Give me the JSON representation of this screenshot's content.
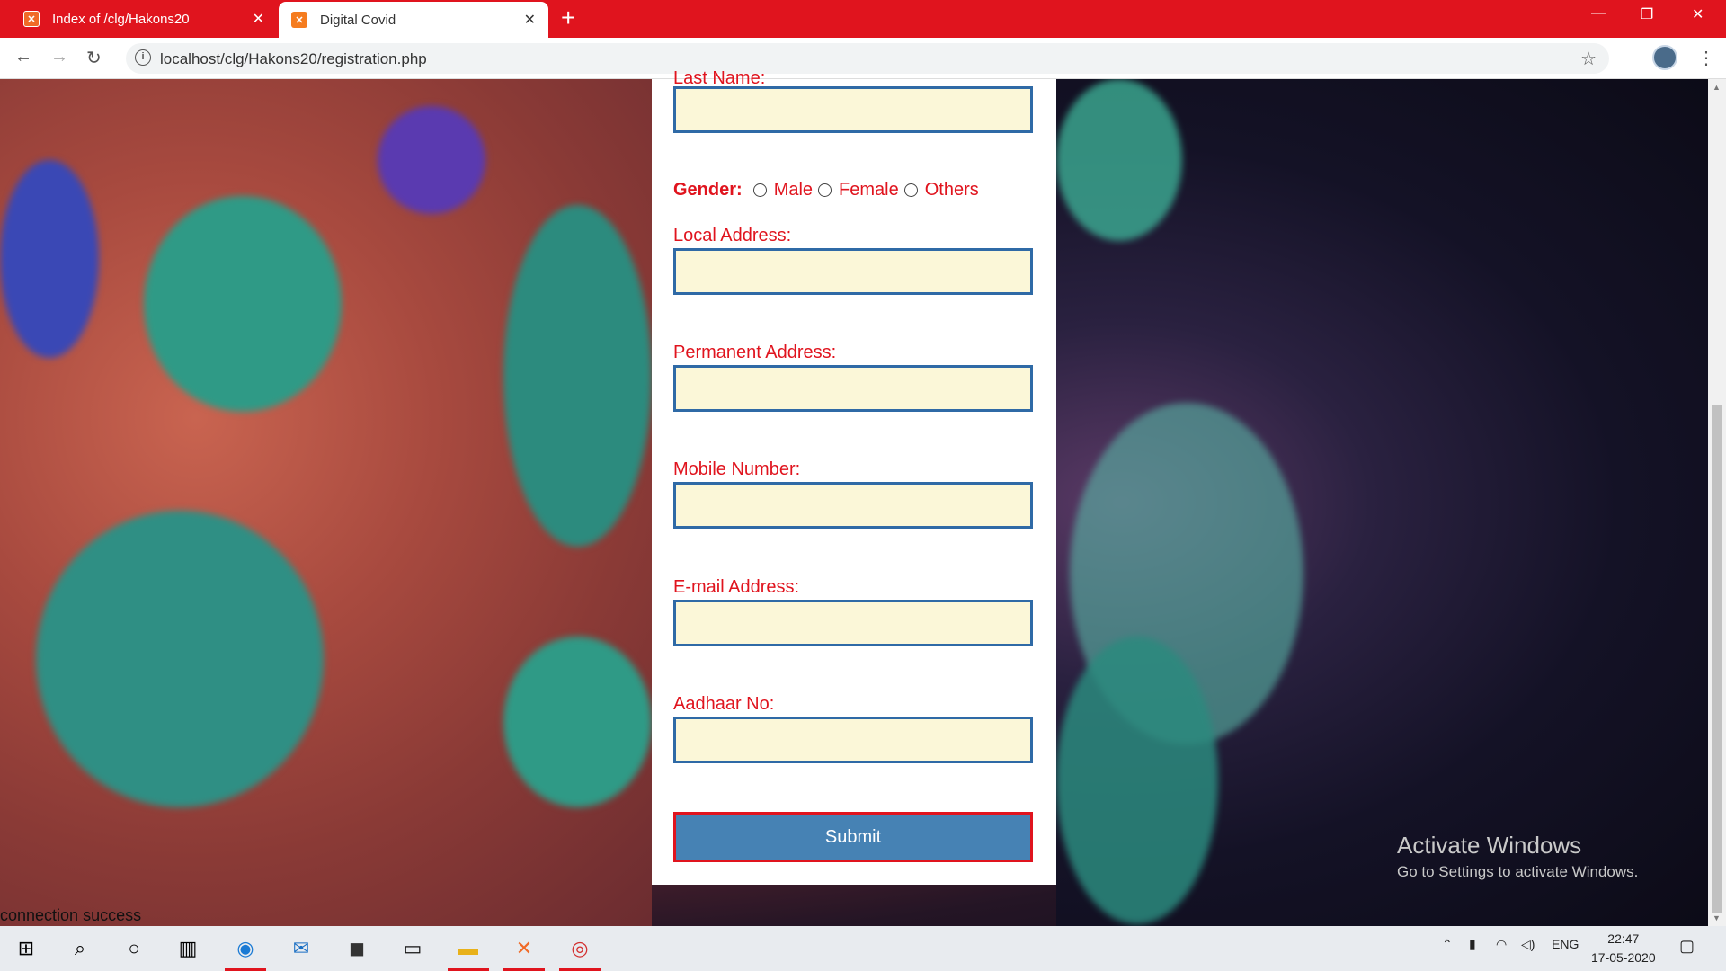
{
  "browser": {
    "tabs": [
      {
        "title": "Index of /clg/Hakons20",
        "active": false
      },
      {
        "title": "Digital Covid",
        "active": true
      }
    ],
    "url": "localhost/clg/Hakons20/registration.php",
    "accent": "#e0141e"
  },
  "form": {
    "cut_label": "Last Name:",
    "gender_label": "Gender:",
    "gender_options": [
      "Male",
      "Female",
      "Others"
    ],
    "labels": {
      "local_address": "Local Address:",
      "permanent_address": "Permanent Address:",
      "mobile_number": "Mobile Number:",
      "email": "E-mail Address:",
      "aadhaar": "Aadhaar No:"
    },
    "submit_label": "Submit",
    "label_color": "#e0141e",
    "field_bg": "#fbf7d8",
    "button_color": "#4682b4"
  },
  "page": {
    "status_text": "connection success"
  },
  "watermark": {
    "title": "Activate Windows",
    "subtitle": "Go to Settings to activate Windows."
  },
  "taskbar": {
    "language": "ENG",
    "time": "22:47",
    "date": "17-05-2020"
  }
}
